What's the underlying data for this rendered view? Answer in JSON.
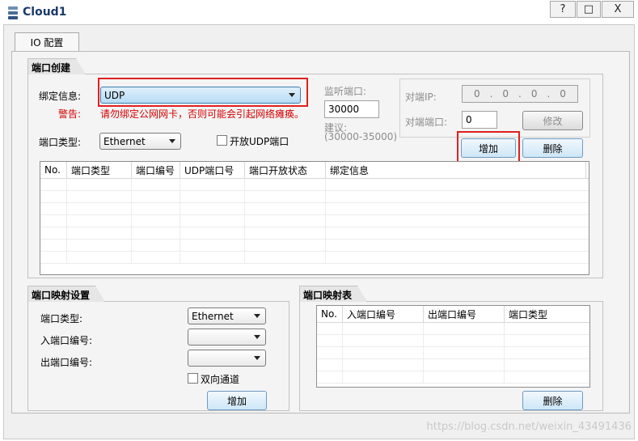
{
  "window": {
    "title": "Cloud1",
    "controls": {
      "help": "?",
      "minimize": "—",
      "maximize": "□",
      "close": "X"
    }
  },
  "tabs": [
    "IO 配置"
  ],
  "port_create": {
    "section_title": "端口创建",
    "bind_label": "绑定信息:",
    "bind_value": "UDP",
    "warning_label": "警告:",
    "warning_text": "请勿绑定公网网卡，否则可能会引起网络瘫痪。",
    "type_label": "端口类型:",
    "type_value": "Ethernet",
    "open_udp_label": "开放UDP端口",
    "listen_label": "监听端口:",
    "listen_value": "30000",
    "advice_label": "建议:",
    "advice_range": "(30000-35000)",
    "peer_ip_label": "对端IP:",
    "peer_ip_octets": [
      "0",
      "0",
      "0",
      "0"
    ],
    "peer_port_label": "对端端口:",
    "peer_port_value": "0",
    "modify_button": "修改",
    "add_button": "增加",
    "delete_button": "删除",
    "table_headers": [
      "No.",
      "端口类型",
      "端口编号",
      "UDP端口号",
      "端口开放状态",
      "绑定信息"
    ]
  },
  "port_mapping_settings": {
    "section_title": "端口映射设置",
    "type_label": "端口类型:",
    "type_value": "Ethernet",
    "in_port_label": "入端口编号:",
    "in_port_value": "",
    "out_port_label": "出端口编号:",
    "out_port_value": "",
    "bidirectional_label": "双向通道",
    "add_button": "增加"
  },
  "port_mapping_table": {
    "section_title": "端口映射表",
    "table_headers": [
      "No.",
      "入端口编号",
      "出端口编号",
      "端口类型"
    ],
    "delete_button": "删除"
  },
  "watermark": "https://blog.csdn.net/weixin_43491436",
  "colors": {
    "highlight": "#e02020",
    "warning": "#d40000",
    "title": "#1a3a6b"
  }
}
